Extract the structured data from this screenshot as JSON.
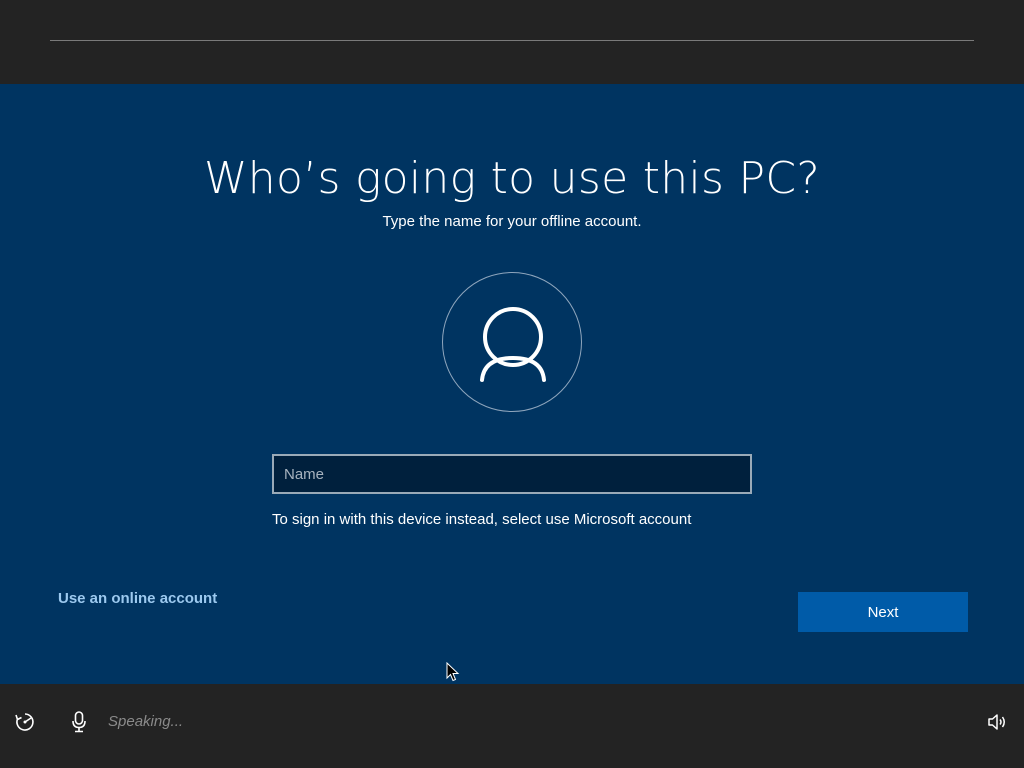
{
  "setup": {
    "title": "Who’s going to use this PC?",
    "subtitle": "Type the name for your offline account.",
    "avatar_icon": "user-icon",
    "name_field": {
      "placeholder": "Name",
      "value": ""
    },
    "hint": "To sign in with this device instead, select use Microsoft account",
    "online_account_link": "Use an online account",
    "next_label": "Next"
  },
  "bottom_bar": {
    "ease_of_access_icon": "ease-of-access-icon",
    "microphone_icon": "microphone-icon",
    "speaking_status": "Speaking...",
    "volume_icon": "volume-icon"
  },
  "colors": {
    "panel_background": "#003461",
    "chrome_background": "#232323",
    "button_accent": "#005ba8",
    "link": "#9cc9ef"
  }
}
